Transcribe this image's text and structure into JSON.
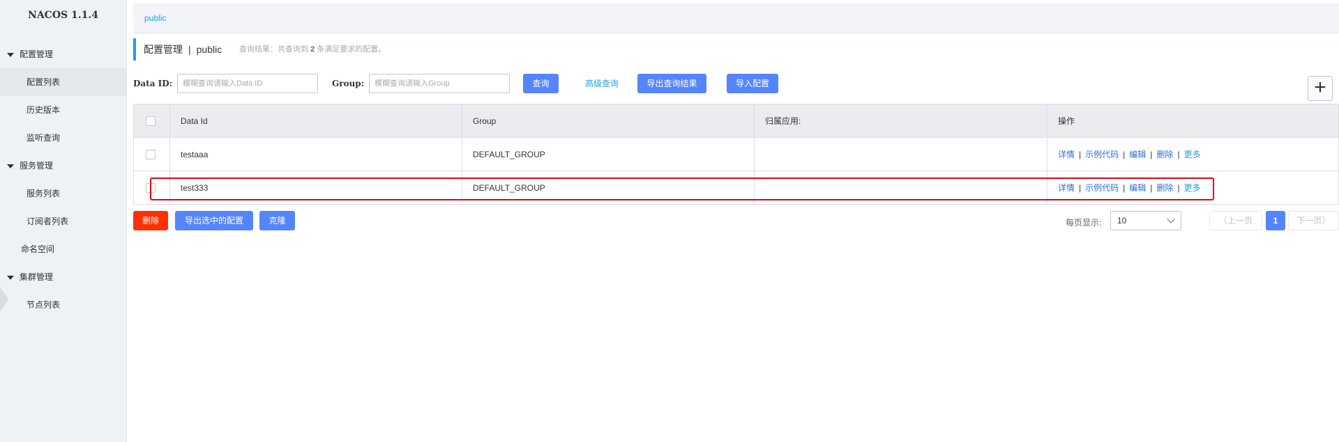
{
  "app": {
    "title": "NACOS 1.1.4"
  },
  "sidebar": {
    "groups": [
      {
        "label": "配置管理",
        "items": [
          "配置列表",
          "历史版本",
          "监听查询"
        ]
      },
      {
        "label": "服务管理",
        "items": [
          "服务列表",
          "订阅者列表"
        ]
      },
      {
        "label": "命名空间"
      },
      {
        "label": "集群管理",
        "items": [
          "节点列表"
        ]
      }
    ],
    "active_item": "配置列表"
  },
  "namespace_bar": {
    "current": "public"
  },
  "header": {
    "title": "配置管理",
    "separator": "|",
    "namespace": "public",
    "summary_prefix": "查询结果：共查询到",
    "summary_count": "2",
    "summary_suffix": "条满足要求的配置。"
  },
  "search": {
    "data_id_label": "Data ID:",
    "data_id_placeholder": "模糊查询请输入Data ID",
    "group_label": "Group:",
    "group_placeholder": "模糊查询请输入Group",
    "query_button": "查询",
    "advanced_link": "高级查询",
    "export_query_button": "导出查询结果",
    "import_button": "导入配置",
    "add_button": "+"
  },
  "table": {
    "columns": [
      "Data Id",
      "Group",
      "归属应用:",
      "操作"
    ],
    "rows": [
      {
        "data_id": "testaaa",
        "group": "DEFAULT_GROUP",
        "app": ""
      },
      {
        "data_id": "test333",
        "group": "DEFAULT_GROUP",
        "app": ""
      }
    ],
    "actions": {
      "detail": "详情",
      "sample": "示例代码",
      "edit": "编辑",
      "delete": "删除",
      "more": "更多",
      "separator": "|"
    }
  },
  "footer": {
    "delete_button": "删除",
    "export_selected_button": "导出选中的配置",
    "clone_button": "克隆",
    "page_size_label": "每页显示:",
    "page_size": "10",
    "prev": "上一页",
    "current_page": "1",
    "next": "下一页"
  },
  "colors": {
    "primary": "#5584ff",
    "danger": "#ff3000",
    "link": "#23a2e0",
    "highlight_box": "#e60012",
    "sidebar_bg": "#eef1f5"
  }
}
